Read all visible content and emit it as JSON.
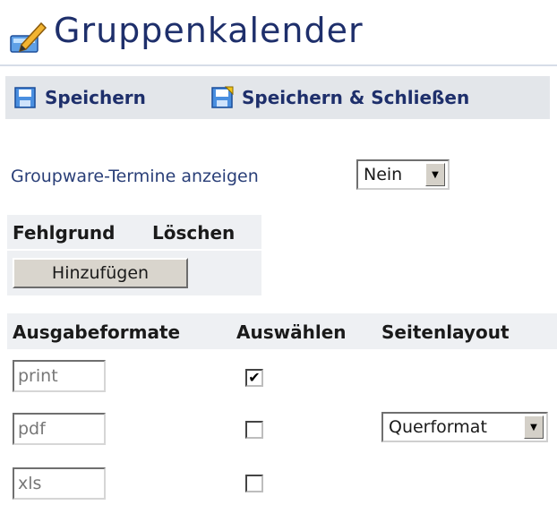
{
  "page": {
    "title": "Gruppenkalender",
    "title_icon": "edit-pencil-icon"
  },
  "toolbar": {
    "save_label": "Speichern",
    "save_close_label": "Speichern & Schließen"
  },
  "groupware": {
    "label": "Groupware-Termine anzeigen",
    "selected": "Nein"
  },
  "fehlgrund_table": {
    "headers": [
      "Fehlgrund",
      "Löschen"
    ],
    "add_label": "Hinzufügen"
  },
  "output_table": {
    "headers": [
      "Ausgabeformate",
      "Auswählen",
      "Seitenlayout"
    ],
    "rows": [
      {
        "format": "print",
        "checked": true,
        "checkmark": "✔"
      },
      {
        "format": "pdf",
        "checked": false,
        "checkmark": "",
        "layout": "Querformat"
      },
      {
        "format": "xls",
        "checked": false,
        "checkmark": ""
      }
    ]
  },
  "colors": {
    "title": "#1e2f6b",
    "toolbar_bg": "#e3e6ea",
    "header_bg": "#eef0f3",
    "link_text": "#2a3f78"
  }
}
